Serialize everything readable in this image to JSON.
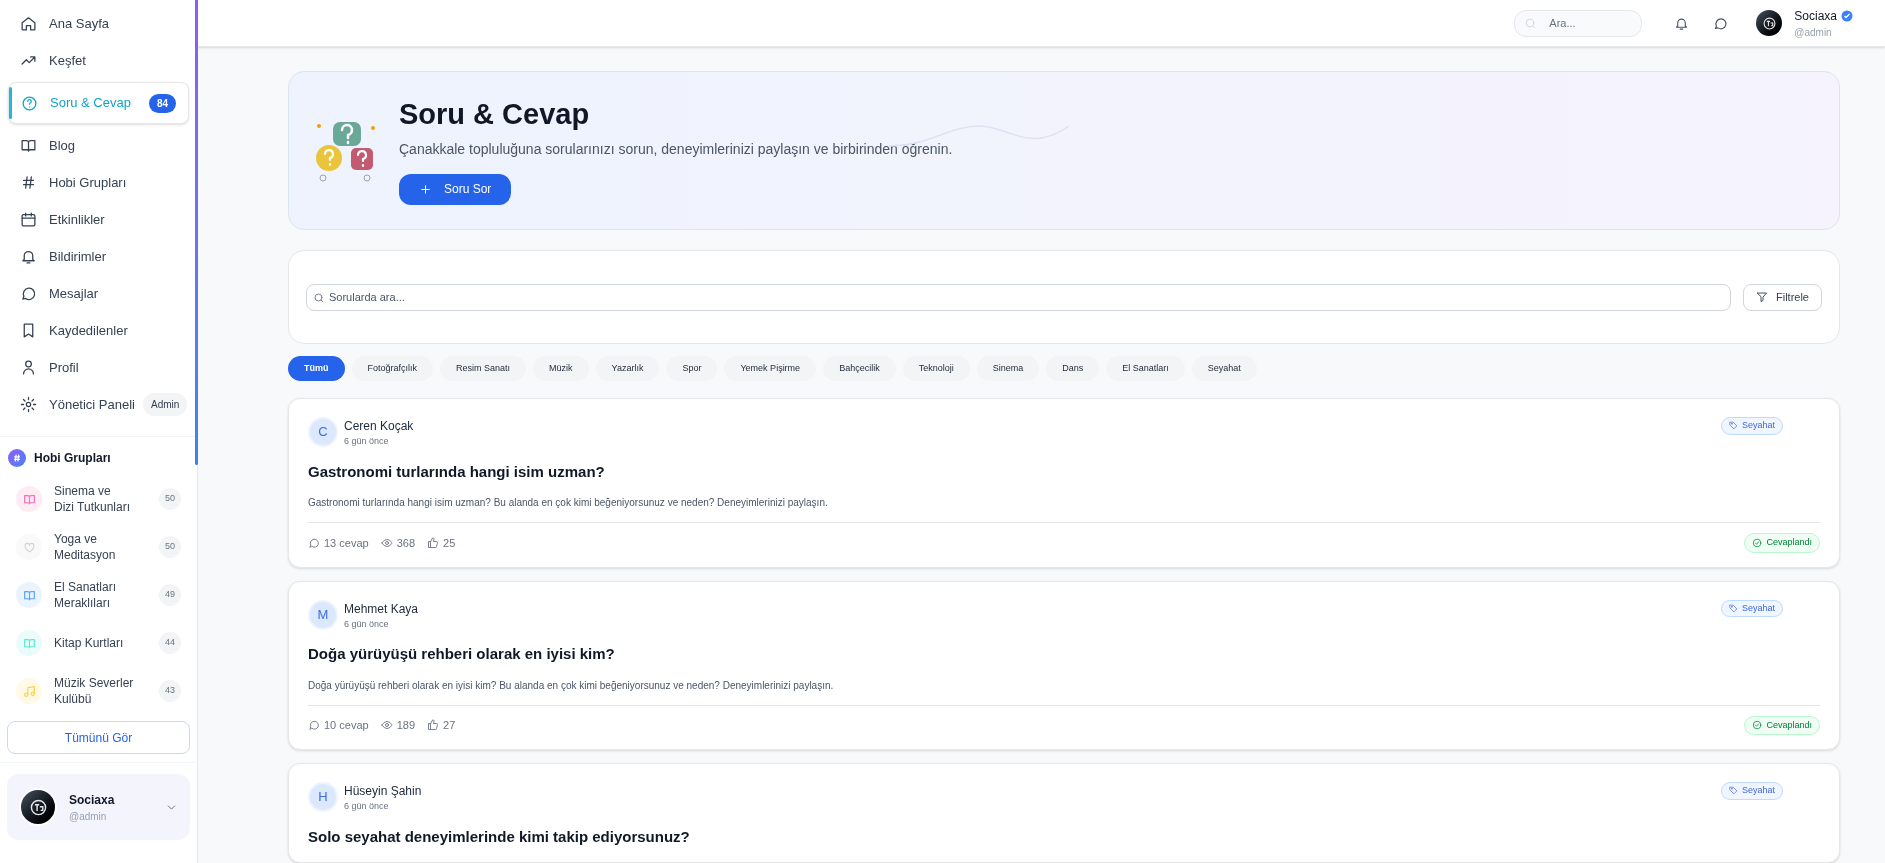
{
  "sidebar": {
    "nav": [
      {
        "label": "Ana Sayfa",
        "selected": false
      },
      {
        "label": "Keşfet",
        "selected": false
      },
      {
        "label": "Soru & Cevap",
        "selected": true,
        "badge": "84"
      },
      {
        "label": "Blog",
        "selected": false
      },
      {
        "label": "Hobi Grupları",
        "selected": false
      },
      {
        "label": "Etkinlikler",
        "selected": false
      },
      {
        "label": "Bildirimler",
        "selected": false
      },
      {
        "label": "Mesajlar",
        "selected": false
      },
      {
        "label": "Kaydedilenler",
        "selected": false
      },
      {
        "label": "Profil",
        "selected": false
      },
      {
        "label": "Yönetici Paneli",
        "selected": false,
        "tag": "Admin"
      }
    ],
    "groups_title": "Hobi Grupları",
    "groups": [
      {
        "name": "Sinema ve Dizi Tutkunları",
        "count": "50",
        "color": "#f472b6"
      },
      {
        "name": "Yoga ve Meditasyon",
        "count": "50",
        "color": "#d1d5db"
      },
      {
        "name": "El Sanatları Meraklıları",
        "count": "49",
        "color": "#60a5fa"
      },
      {
        "name": "Kitap Kurtları",
        "count": "44",
        "color": "#5eead4"
      },
      {
        "name": "Müzik Severler Kulübü",
        "count": "43",
        "color": "#fcd34d"
      }
    ],
    "see_all": "Tümünü Gör",
    "user": {
      "name": "Sociaxa",
      "handle": "@admin"
    }
  },
  "header": {
    "search_placeholder": "Ara...",
    "user": {
      "name": "Sociaxa",
      "handle": "@admin",
      "verified": true
    }
  },
  "hero": {
    "title": "Soru & Cevap",
    "subtitle": "Çanakkale topluluğuna sorularınızı sorun, deneyimlerinizi paylaşın ve birbirinden öğrenin.",
    "button": "Soru Sor"
  },
  "search": {
    "placeholder": "Sorularda ara...",
    "filter": "Filtrele"
  },
  "categories": [
    {
      "label": "Tümü",
      "selected": true
    },
    {
      "label": "Fotoğrafçılık",
      "selected": false
    },
    {
      "label": "Resim Sanatı",
      "selected": false
    },
    {
      "label": "Müzik",
      "selected": false
    },
    {
      "label": "Yazarlık",
      "selected": false
    },
    {
      "label": "Spor",
      "selected": false
    },
    {
      "label": "Yemek Pişirme",
      "selected": false
    },
    {
      "label": "Bahçecilik",
      "selected": false
    },
    {
      "label": "Teknoloji",
      "selected": false
    },
    {
      "label": "Sinema",
      "selected": false
    },
    {
      "label": "Dans",
      "selected": false
    },
    {
      "label": "El Sanatları",
      "selected": false
    },
    {
      "label": "Seyahat",
      "selected": false
    }
  ],
  "questions": [
    {
      "initial": "C",
      "author": "Ceren Koçak",
      "time": "6 gün önce",
      "tag": "Seyahat",
      "title": "Gastronomi turlarında hangi isim uzman?",
      "body": "Gastronomi turlarında hangi isim uzman? Bu alanda en çok kimi beğeniyorsunuz ve neden? Deneyimlerinizi paylaşın.",
      "answers": "13 cevap",
      "views": "368",
      "likes": "25",
      "answered": true,
      "status": "Cevaplandı"
    },
    {
      "initial": "M",
      "author": "Mehmet Kaya",
      "time": "6 gün önce",
      "tag": "Seyahat",
      "title": "Doğa yürüyüşü rehberi olarak en iyisi kim?",
      "body": "Doğa yürüyüşü rehberi olarak en iyisi kim? Bu alanda en çok kimi beğeniyorsunuz ve neden? Deneyimlerinizi paylaşın.",
      "answers": "10 cevap",
      "views": "189",
      "likes": "27",
      "answered": true,
      "status": "Cevaplandı"
    },
    {
      "initial": "H",
      "author": "Hüseyin Şahin",
      "time": "6 gün önce",
      "tag": "Seyahat",
      "title": "Solo seyahat deneyimlerinde kimi takip ediyorsunuz?"
    }
  ]
}
